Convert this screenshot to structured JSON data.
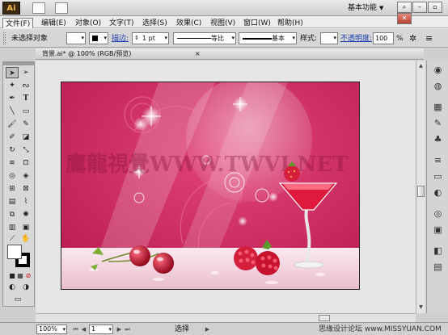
{
  "app": {
    "logo_text": "Ai"
  },
  "menu": {
    "items": [
      "文件(F)",
      "编辑(E)",
      "对象(O)",
      "文字(T)",
      "选择(S)",
      "效果(C)",
      "视图(V)",
      "窗口(W)",
      "帮助(H)"
    ],
    "workspace_label": "基本功能"
  },
  "control_bar": {
    "selection_label": "未选择对象",
    "stroke_link": "描边:",
    "stroke_weight": "1 pt",
    "profile_label": "等比",
    "brush_label": "基本",
    "style_label": "样式:",
    "opacity_link": "不透明度:",
    "opacity_value": "100",
    "opacity_unit": "%"
  },
  "document": {
    "tab_title": "背景.ai* @ 100% (RGB/预览)",
    "close_glyph": "×"
  },
  "artwork": {
    "watermark": "鷹龍視覺WWW.TWVI.NET",
    "colors": {
      "background": "#c8255c",
      "floor": "#f3d7e1"
    }
  },
  "status_bar": {
    "zoom": "100%",
    "page": "1",
    "tool_status": "选择",
    "credit": "思缘设计论坛  www.MISSYUAN.COM"
  }
}
